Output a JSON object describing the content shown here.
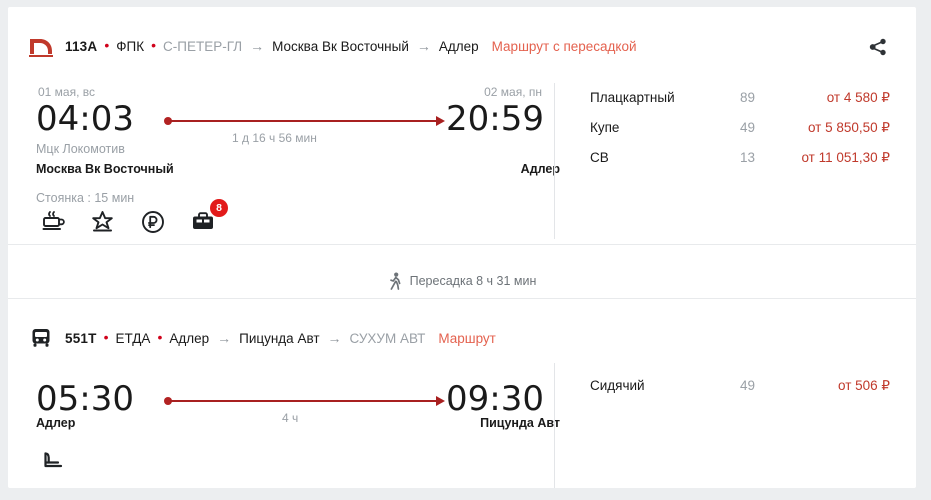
{
  "brand": {
    "accent_red": "#d0021b",
    "link_red": "#e4624f",
    "price_red": "#c0392b",
    "line_red": "#a82020",
    "muted_gray": "#9aa0a6"
  },
  "share": {
    "icon": "share-icon",
    "label": "Поделиться"
  },
  "segments": [
    {
      "mode_icon": "train-icon",
      "header": {
        "number": "113А",
        "carrier": "ФПК",
        "origin": "С-ПЕТЕР-ГЛ",
        "arrow1": "→",
        "from": "Москва Вк Восточный",
        "arrow2": "→",
        "to": "Адлер",
        "link": "Маршрут с пересадкой"
      },
      "depart": {
        "date": "01 мая, вс",
        "time": "04:03",
        "station_sub": "Мцк Локомотив",
        "station": "Москва Вк Восточный",
        "stop_note": "Стоянка : 15 мин"
      },
      "arrive": {
        "date": "02 мая, пн",
        "time": "20:59",
        "station": "Адлер"
      },
      "duration": "1 д 16 ч 56 мин",
      "amenities": [
        {
          "icon": "tea-cup-icon",
          "badge": ""
        },
        {
          "icon": "star-icon",
          "badge": ""
        },
        {
          "icon": "ruble-coin-icon",
          "badge": ""
        },
        {
          "icon": "briefcase-icon",
          "badge": "8"
        }
      ],
      "fares": [
        {
          "class": "Плацкартный",
          "seats": "89",
          "price": "от 4 580 ₽"
        },
        {
          "class": "Купе",
          "seats": "49",
          "price": "от 5 850,50 ₽"
        },
        {
          "class": "СВ",
          "seats": "13",
          "price": "от 11 051,30 ₽"
        }
      ]
    },
    {
      "mode_icon": "bus-icon",
      "header": {
        "number": "551Т",
        "carrier": "ЕТДА",
        "origin": "Адлер",
        "arrow1": "→",
        "from": "Пицунда Авт",
        "arrow2": "→",
        "to": "СУХУМ АВТ",
        "link": "Маршрут"
      },
      "depart": {
        "date": "",
        "time": "05:30",
        "station_sub": "",
        "station": "Адлер",
        "stop_note": ""
      },
      "arrive": {
        "date": "",
        "time": "09:30",
        "station": "Пицунда Авт"
      },
      "duration": "4 ч",
      "amenities": [
        {
          "icon": "seat-icon",
          "badge": ""
        }
      ],
      "fares": [
        {
          "class": "Сидячий",
          "seats": "49",
          "price": "от 506 ₽"
        }
      ]
    }
  ],
  "transfer": {
    "icon": "walking-person-icon",
    "text": "Пересадка 8 ч 31 мин"
  }
}
